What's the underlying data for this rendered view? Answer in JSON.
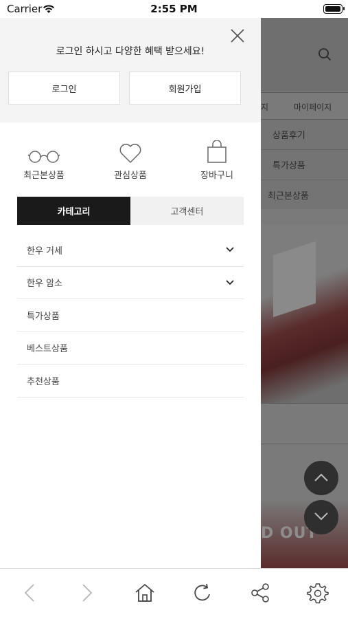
{
  "status_bar": {
    "carrier": "Carrier",
    "time": "2:55 PM"
  },
  "background_page": {
    "tab_partial": "지",
    "tab_mypage": "마이페이지",
    "links": [
      "상품후기",
      "특가상품",
      "최근본상품"
    ],
    "banner_text": "D OUT"
  },
  "drawer": {
    "promo_text": "로그인 하시고 다양한 혜택 받으세요!",
    "login_label": "로그인",
    "signup_label": "회원가입",
    "quick_links": [
      {
        "label": "최근본상품",
        "icon": "glasses-icon"
      },
      {
        "label": "관심상품",
        "icon": "heart-icon"
      },
      {
        "label": "장바구니",
        "icon": "shopping-bag-icon"
      }
    ],
    "tabs": {
      "category": "카테고리",
      "customer_center": "고객센터",
      "active": "category"
    },
    "menu_items": [
      {
        "label": "한우 거세",
        "expandable": true
      },
      {
        "label": "한우 암소",
        "expandable": true
      },
      {
        "label": "특가상품",
        "expandable": false
      },
      {
        "label": "베스트상품",
        "expandable": false
      },
      {
        "label": "추천상품",
        "expandable": false
      }
    ]
  },
  "toolbar": [
    "back-icon",
    "forward-icon",
    "home-icon",
    "refresh-icon",
    "share-icon",
    "settings-icon"
  ],
  "colors": {
    "active_tab": "#1a1a1a",
    "overlay": "#7a7a7a",
    "panel_top": "#f4f4f4"
  }
}
